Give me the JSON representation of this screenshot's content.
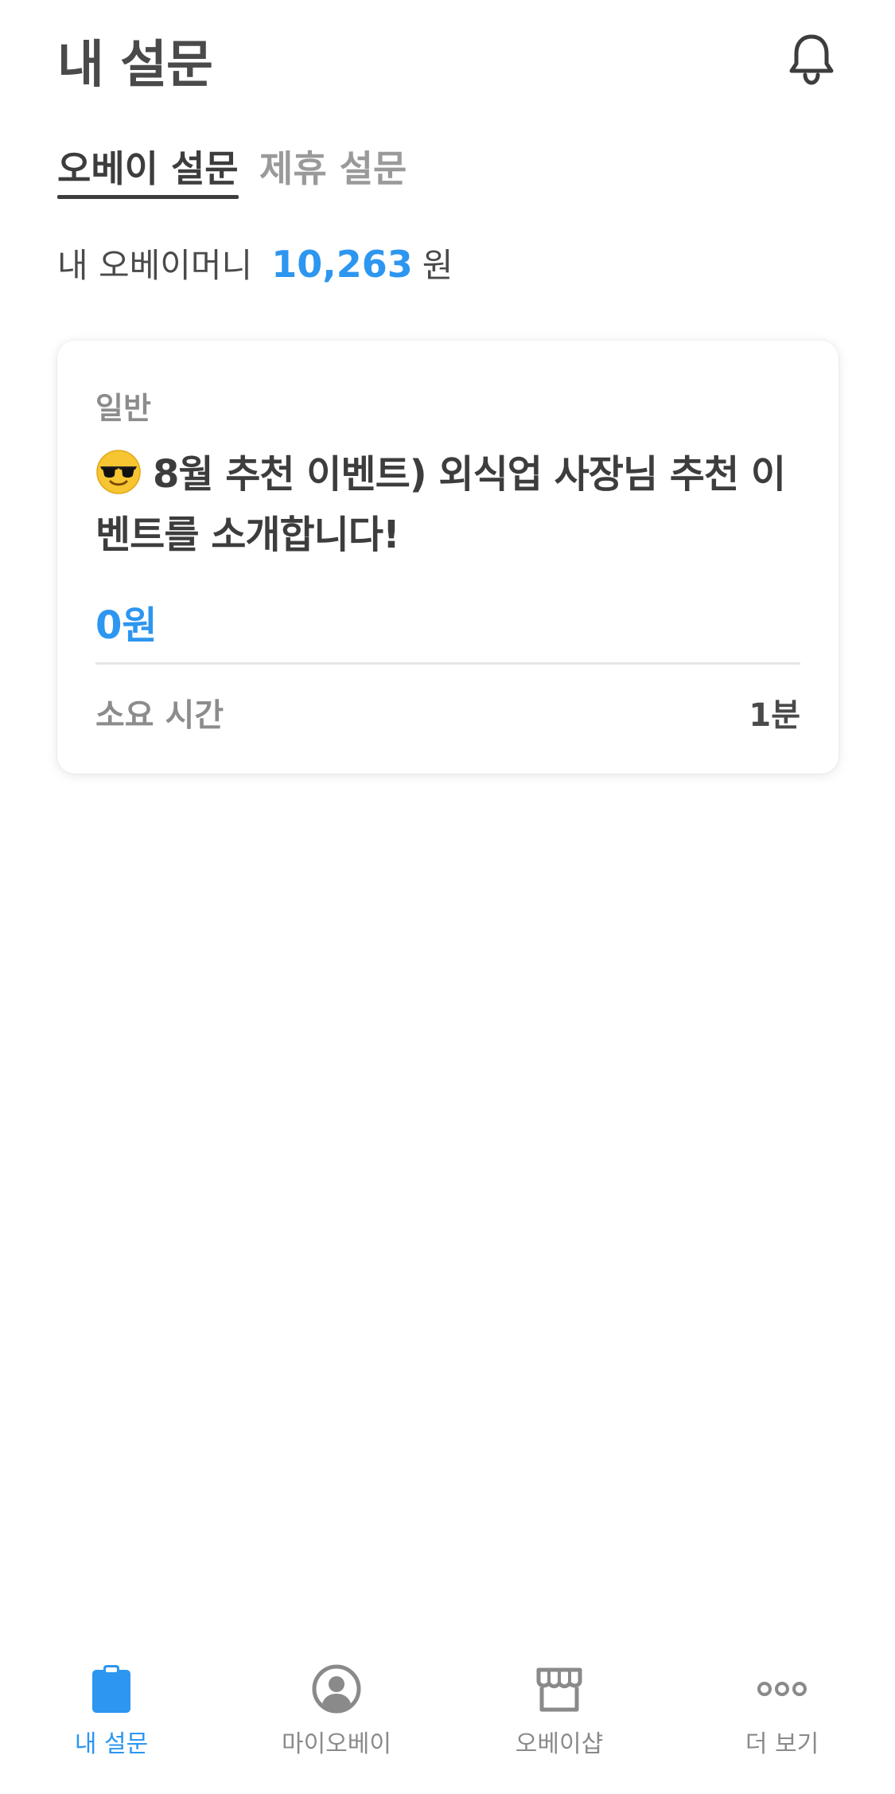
{
  "header": {
    "title": "내 설문",
    "notification_icon": "bell-icon"
  },
  "tabs": [
    {
      "label": "오베이 설문",
      "active": true
    },
    {
      "label": "제휴 설문",
      "active": false
    }
  ],
  "money": {
    "label": "내 오베이머니",
    "amount": "10,263",
    "unit": "원"
  },
  "surveys": [
    {
      "category": "일반",
      "emoji": "sunglasses-emoji",
      "title": "8월 추천 이벤트) 외식업 사장님 추천 이벤트를 소개합니다!",
      "reward": "0원",
      "time_label": "소요 시간",
      "time_value": "1분"
    }
  ],
  "bottom_nav": [
    {
      "label": "내 설문",
      "icon": "clipboard-icon",
      "active": true
    },
    {
      "label": "마이오베이",
      "icon": "profile-icon",
      "active": false
    },
    {
      "label": "오베이샵",
      "icon": "shop-icon",
      "active": false
    },
    {
      "label": "더 보기",
      "icon": "more-icon",
      "active": false
    }
  ],
  "colors": {
    "accent": "#2d96f0",
    "text_dark": "#3d3d3d",
    "text_muted": "#8c8c8c"
  }
}
